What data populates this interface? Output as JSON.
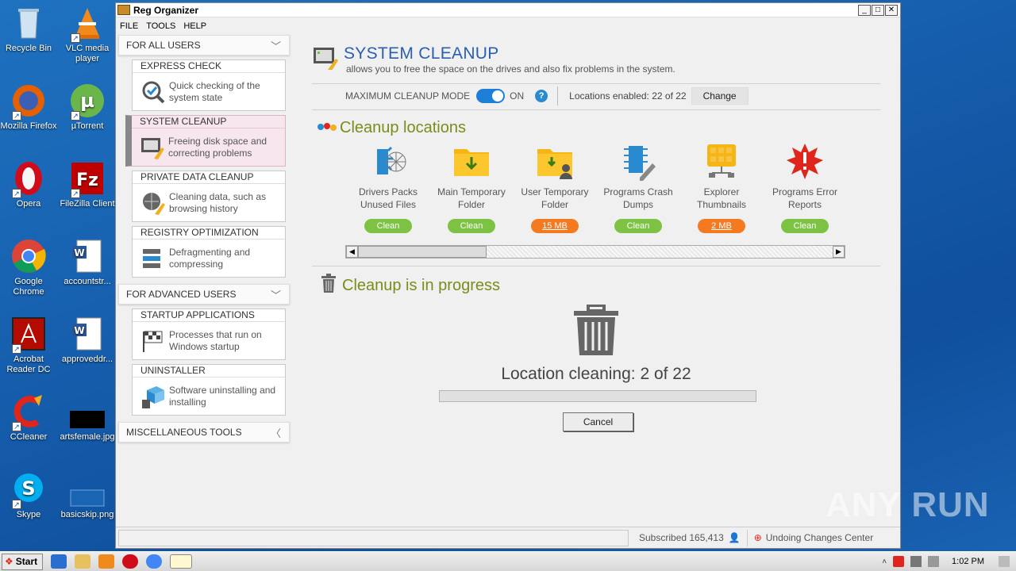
{
  "desktop": {
    "icons": [
      {
        "label": "Recycle Bin"
      },
      {
        "label": "VLC media player"
      },
      {
        "label": "Mozilla Firefox"
      },
      {
        "label": "µTorrent"
      },
      {
        "label": "Opera"
      },
      {
        "label": "FileZilla Client"
      },
      {
        "label": "Google Chrome"
      },
      {
        "label": "accountstr..."
      },
      {
        "label": "Acrobat Reader DC"
      },
      {
        "label": "approveddr..."
      },
      {
        "label": "CCleaner"
      },
      {
        "label": "artsfemale.jpg"
      },
      {
        "label": "Skype"
      },
      {
        "label": "basicskip.png"
      }
    ]
  },
  "window": {
    "title": "Reg Organizer",
    "menu": [
      "FILE",
      "TOOLS",
      "HELP"
    ]
  },
  "sidebar": {
    "for_all_users": "FOR ALL USERS",
    "for_advanced_users": "FOR ADVANCED USERS",
    "misc_tools": "MISCELLANEOUS TOOLS",
    "cards": [
      {
        "title": "EXPRESS CHECK",
        "desc": "Quick checking of the system state"
      },
      {
        "title": "SYSTEM CLEANUP",
        "desc": "Freeing disk space and correcting problems"
      },
      {
        "title": "PRIVATE DATA CLEANUP",
        "desc": "Cleaning data, such as browsing history"
      },
      {
        "title": "REGISTRY OPTIMIZATION",
        "desc": "Defragmenting and compressing"
      },
      {
        "title": "STARTUP APPLICATIONS",
        "desc": "Processes that run on Windows startup"
      },
      {
        "title": "UNINSTALLER",
        "desc": "Software uninstalling and installing"
      }
    ]
  },
  "main": {
    "title": "SYSTEM CLEANUP",
    "subtitle": "allows you to free the space on the drives and also fix problems in the system.",
    "mode_label": "MAXIMUM CLEANUP MODE",
    "mode_state": "ON",
    "locations_enabled": "Locations enabled: 22 of 22",
    "change_label": "Change",
    "cleanup_locations_title": "Cleanup locations",
    "tiles": [
      {
        "label": "Drivers Packs Unused Files",
        "action": "Clean"
      },
      {
        "label": "Main Temporary Folder",
        "action": "Clean"
      },
      {
        "label": "User Temporary Folder",
        "action": "15 MB"
      },
      {
        "label": "Programs Crash Dumps",
        "action": "Clean"
      },
      {
        "label": "Explorer Thumbnails",
        "action": "2 MB"
      },
      {
        "label": "Programs Error Reports",
        "action": "Clean"
      }
    ],
    "progress_title": "Cleanup is in progress",
    "location_cleaning": "Location cleaning: 2 of 22",
    "progress_fraction": 0.0,
    "cancel_label": "Cancel"
  },
  "statusbar": {
    "subscribed": "Subscribed 165,413",
    "undo": "Undoing Changes Center"
  },
  "taskbar": {
    "start": "Start",
    "clock": "1:02 PM"
  },
  "watermark": "ANY RUN"
}
